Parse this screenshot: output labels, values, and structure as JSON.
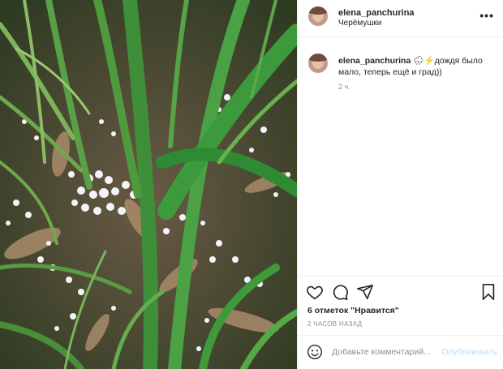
{
  "post": {
    "username": "elena_panchurina",
    "location": "Черёмушки",
    "caption_text": "🌧⚡дождя было мало, теперь ещё и град))",
    "caption_time": "2 ч.",
    "likes": "6 отметок \"Нравится\"",
    "time_ago": "2 ЧАСОВ НАЗАД"
  },
  "header": {
    "more_icon": "•••"
  },
  "comment": {
    "placeholder": "Добавьте комментарий...",
    "publish_label": "Опубликовать"
  },
  "icons": [
    "heart-icon",
    "comment-icon",
    "share-icon",
    "bookmark-icon",
    "emoji-icon",
    "more-icon"
  ],
  "colors": {
    "link_disabled": "#b2dffc",
    "secondary_text": "#8e8e8e",
    "divider": "#efefef"
  }
}
